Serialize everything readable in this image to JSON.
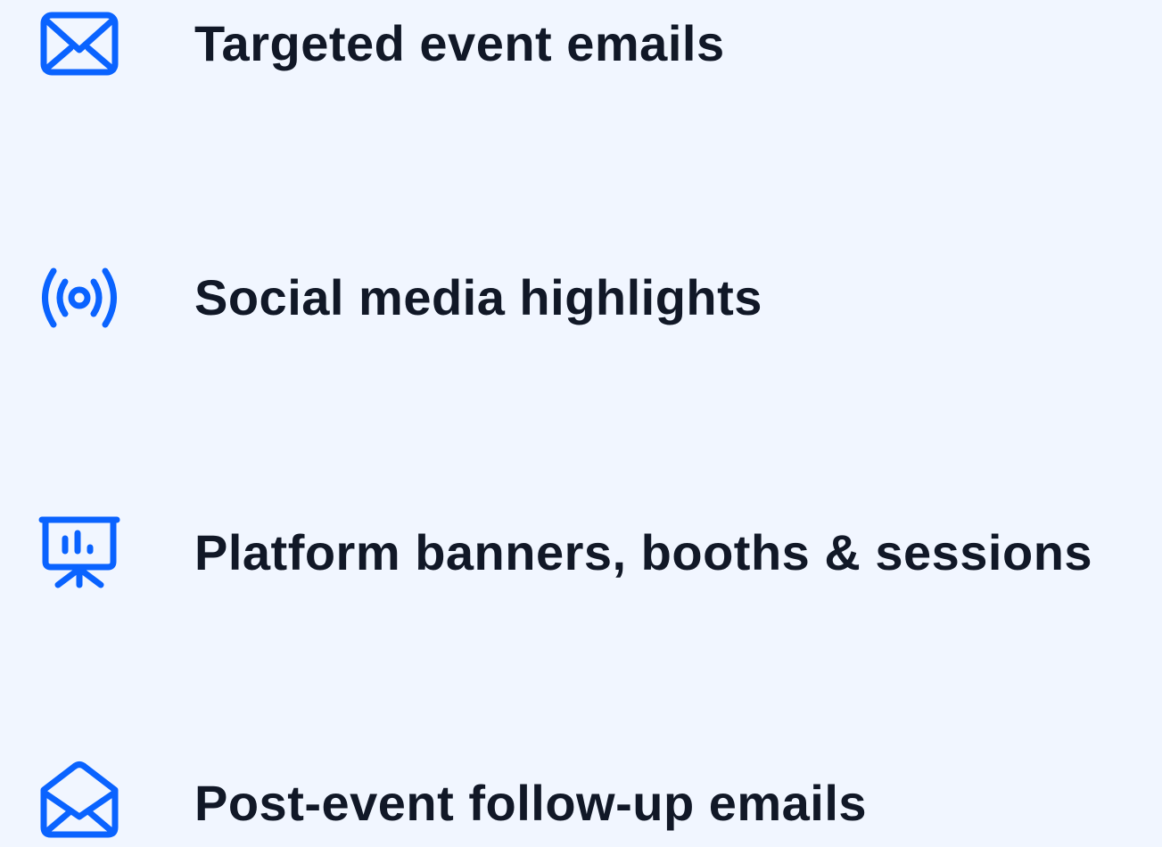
{
  "theme": {
    "background": "#f1f6ff",
    "icon_color": "#0a63ff",
    "text_color": "#111827"
  },
  "features": [
    {
      "icon": "envelope-icon",
      "label": "Targeted event emails"
    },
    {
      "icon": "broadcast-icon",
      "label": "Social media highlights"
    },
    {
      "icon": "presentation-board-icon",
      "label": "Platform banners, booths & sessions"
    },
    {
      "icon": "open-envelope-icon",
      "label": "Post-event follow-up emails"
    }
  ]
}
